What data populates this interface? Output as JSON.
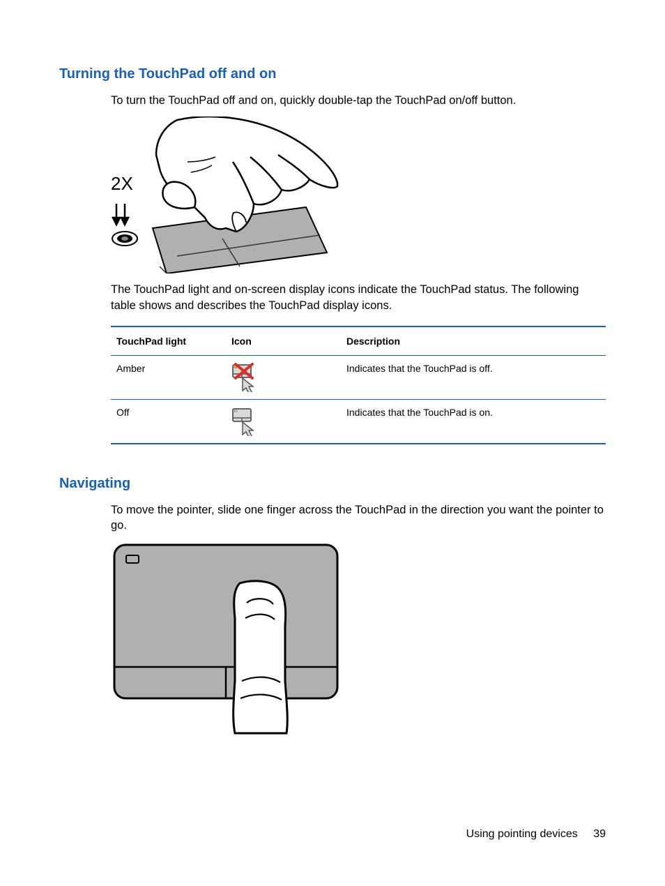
{
  "section1": {
    "heading": "Turning the TouchPad off and on",
    "p1": "To turn the TouchPad off and on, quickly double-tap the TouchPad on/off button.",
    "p2": "The TouchPad light and on-screen display icons indicate the TouchPad status. The following table shows and describes the TouchPad display icons.",
    "illus_label": "2X"
  },
  "table": {
    "headers": {
      "light": "TouchPad light",
      "icon": "Icon",
      "desc": "Description"
    },
    "rows": [
      {
        "light": "Amber",
        "desc": "Indicates that the TouchPad is off."
      },
      {
        "light": "Off",
        "desc": "Indicates that the TouchPad is on."
      }
    ]
  },
  "section2": {
    "heading": "Navigating",
    "p1": "To move the pointer, slide one finger across the TouchPad in the direction you want the pointer to go."
  },
  "footer": {
    "section": "Using pointing devices",
    "page": "39"
  }
}
